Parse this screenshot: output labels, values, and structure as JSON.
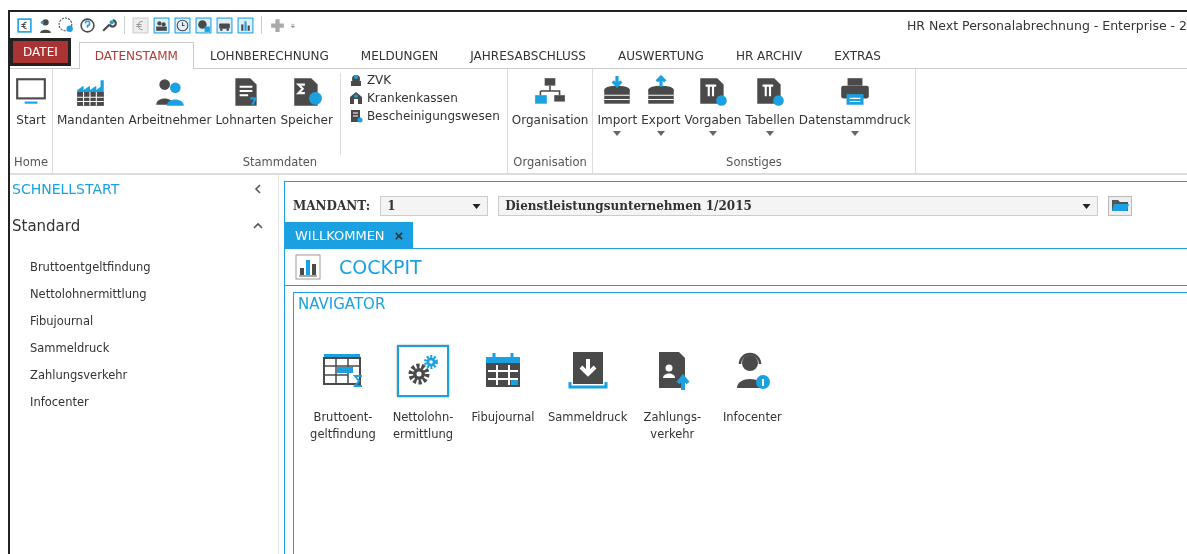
{
  "window": {
    "title": "HR Next Personalabrechnung - Enterprise - 2"
  },
  "menu_tabs": [
    {
      "label": "DATEI",
      "kind": "file",
      "selected": false
    },
    {
      "label": "DATENSTAMM",
      "kind": "tab",
      "selected": true
    },
    {
      "label": "LOHNBERECHNUNG",
      "kind": "tab",
      "selected": false
    },
    {
      "label": "MELDUNGEN",
      "kind": "tab",
      "selected": false
    },
    {
      "label": "JAHRESABSCHLUSS",
      "kind": "tab",
      "selected": false
    },
    {
      "label": "AUSWERTUNG",
      "kind": "tab",
      "selected": false
    },
    {
      "label": "HR ARCHIV",
      "kind": "tab",
      "selected": false
    },
    {
      "label": "EXTRAS",
      "kind": "tab",
      "selected": false
    }
  ],
  "ribbon_groups": [
    {
      "label": "Home",
      "items": [
        {
          "kind": "large",
          "label": "Start",
          "dropdown": false
        }
      ]
    },
    {
      "label": "Stammdaten",
      "items": [
        {
          "kind": "large",
          "label": "Mandanten",
          "dropdown": false
        },
        {
          "kind": "large",
          "label": "Arbeitnehmer",
          "dropdown": false
        },
        {
          "kind": "large",
          "label": "Lohnarten",
          "dropdown": false
        },
        {
          "kind": "large",
          "label": "Speicher",
          "dropdown": false
        },
        {
          "kind": "small_list",
          "entries": [
            "ZVK",
            "Krankenkassen",
            "Bescheinigungswesen"
          ]
        }
      ]
    },
    {
      "label": "Organisation",
      "items": [
        {
          "kind": "large",
          "label": "Organisation",
          "dropdown": false
        }
      ]
    },
    {
      "label": "Sonstiges",
      "items": [
        {
          "kind": "large",
          "label": "Import",
          "dropdown": true
        },
        {
          "kind": "large",
          "label": "Export",
          "dropdown": true
        },
        {
          "kind": "large",
          "label": "Vorgaben",
          "dropdown": true
        },
        {
          "kind": "large",
          "label": "Tabellen",
          "dropdown": true
        },
        {
          "kind": "large",
          "label": "Datenstammdruck",
          "dropdown": true
        }
      ]
    }
  ],
  "sidebar": {
    "title": "SCHNELLSTART",
    "section": "Standard",
    "items": [
      "Bruttoentgeltfindung",
      "Nettolohnermittlung",
      "Fibujournal",
      "Sammeldruck",
      "Zahlungsverkehr",
      "Infocenter"
    ]
  },
  "mandant": {
    "label": "MANDANT:",
    "number": "1",
    "name": "Dienstleistungsunternehmen 1/2015"
  },
  "doc_tab": {
    "label": "WILLKOMMEN",
    "close": "×"
  },
  "cockpit": {
    "title": "COCKPIT"
  },
  "navigator": {
    "title": "NAVIGATOR",
    "items": [
      {
        "lines": [
          "Bruttoent-",
          "geltfindung"
        ],
        "selected": false
      },
      {
        "lines": [
          "Nettolohn-",
          "ermittlung"
        ],
        "selected": true
      },
      {
        "lines": [
          "Fibujournal"
        ],
        "selected": false
      },
      {
        "lines": [
          "Sammeldruck"
        ],
        "selected": false
      },
      {
        "lines": [
          "Zahlungs-",
          "verkehr"
        ],
        "selected": false
      },
      {
        "lines": [
          "Infocenter"
        ],
        "selected": false
      }
    ]
  }
}
